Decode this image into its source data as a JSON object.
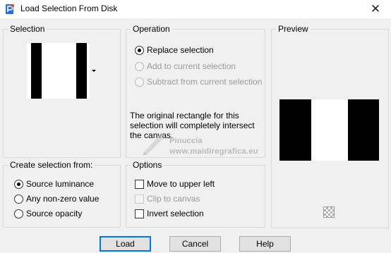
{
  "window": {
    "title": "Load Selection From Disk",
    "close_glyph": "✕"
  },
  "selection_group": {
    "label": "Selection"
  },
  "operation_group": {
    "label": "Operation",
    "options": [
      {
        "label": "Replace selection",
        "checked": true,
        "enabled": true
      },
      {
        "label": "Add to current selection",
        "checked": false,
        "enabled": false
      },
      {
        "label": "Subtract from current selection",
        "checked": false,
        "enabled": false
      }
    ],
    "info_text": "The original rectangle for this selection will completely intersect the canvas."
  },
  "watermark": {
    "line1": "Pinuccia",
    "line2": "www.maidiregrafica.eu"
  },
  "preview_group": {
    "label": "Preview"
  },
  "create_group": {
    "label": "Create selection from:",
    "options": [
      {
        "label": "Source luminance",
        "checked": true
      },
      {
        "label": "Any non-zero value",
        "checked": false
      },
      {
        "label": "Source opacity",
        "checked": false
      }
    ]
  },
  "options_group": {
    "label": "Options",
    "items": [
      {
        "label": "Move to upper left",
        "checked": false,
        "enabled": true
      },
      {
        "label": "Clip to canvas",
        "checked": false,
        "enabled": false
      },
      {
        "label": "Invert selection",
        "checked": false,
        "enabled": true
      }
    ]
  },
  "buttons": {
    "load": "Load",
    "cancel": "Cancel",
    "help": "Help"
  },
  "icons": {
    "app": "psp-app-icon",
    "close": "close-icon",
    "dropdown": "chevron-down-icon",
    "transparency": "transparency-checker-icon"
  },
  "colors": {
    "window_bg": "#f0f0f0",
    "title_bg": "#ffffff",
    "group_border": "#d9d9d9",
    "default_button_border": "#0078d7",
    "disabled_text": "#9a9a9a"
  }
}
